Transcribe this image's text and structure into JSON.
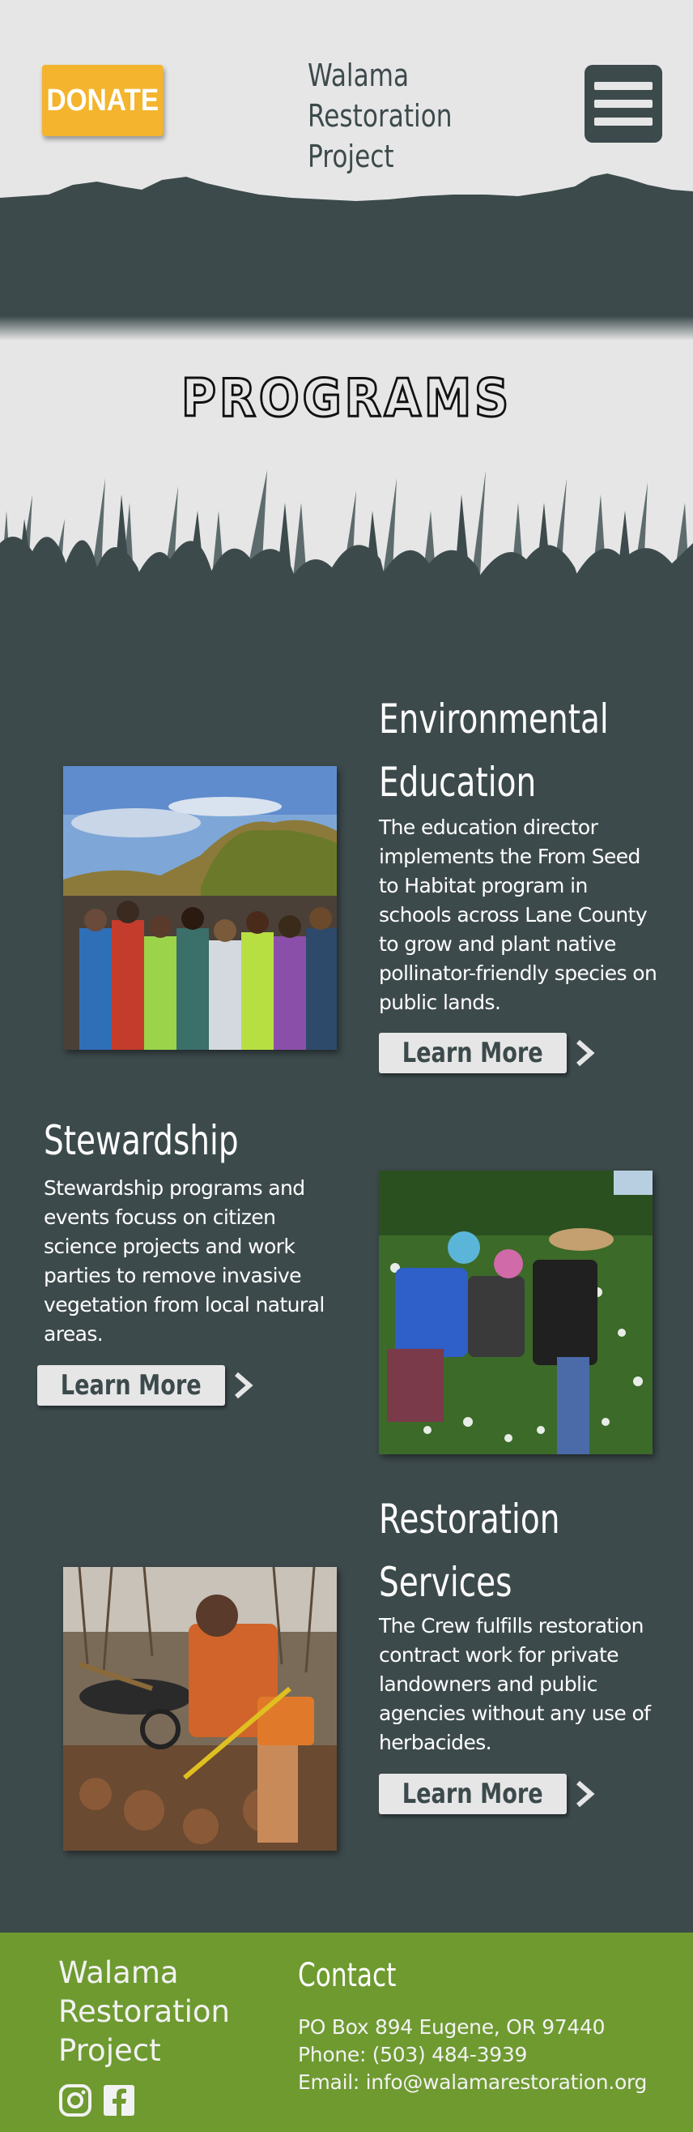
{
  "header": {
    "donate_label": "DONATE",
    "site_title": "Walama\nRestoration\nProject",
    "menu_icon": "hamburger-menu-icon"
  },
  "page_title": "PROGRAMS",
  "programs": [
    {
      "title": "Environmental\nEducation",
      "description": "The education director implements the From Seed to Habitat program in schools across Lane County to grow and plant native pollinator-friendly species on public lands.",
      "button_label": "Learn More"
    },
    {
      "title": "Stewardship",
      "description": "Stewardship programs and events focuss on citizen science projects and work parties to remove invasive vegetation from local natural areas.",
      "button_label": "Learn More"
    },
    {
      "title": "Restoration\nServices",
      "description": "The Crew fulfills restoration contract work for private landowners and public agencies without any use of herbacides.",
      "button_label": "Learn More"
    }
  ],
  "footer": {
    "org_name": "Walama\nRestoration\nProject",
    "contact_title": "Contact",
    "address": "PO Box 894 Eugene, OR 97440",
    "phone": "Phone: (503) 484-3939",
    "email": "Email: info@walamarestoration.org",
    "social_icons": [
      "instagram-icon",
      "facebook-icon"
    ]
  },
  "colors": {
    "background": "#e6e6e6",
    "dark_slate": "#3d4a4c",
    "donate_yellow": "#f4b42d",
    "footer_green": "#6e9a30"
  }
}
